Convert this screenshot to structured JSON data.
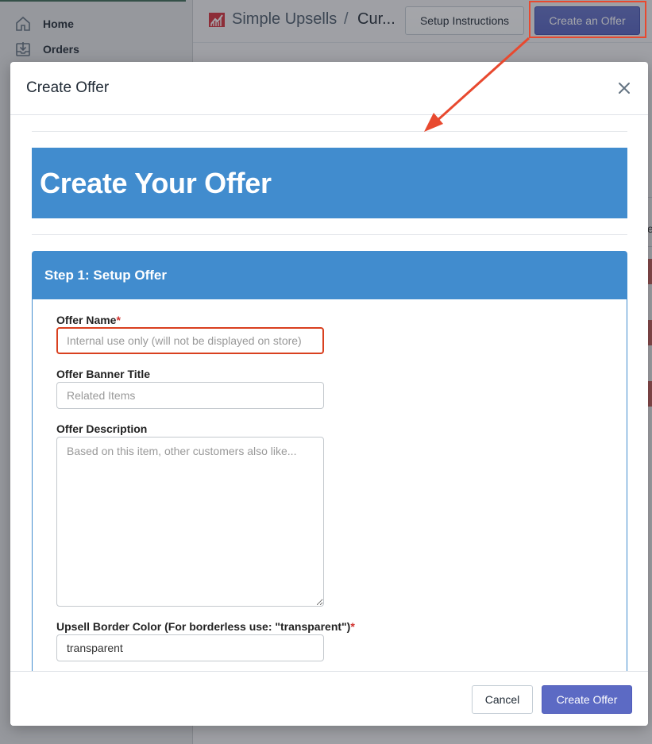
{
  "sidebar": {
    "items": [
      {
        "label": "Home",
        "icon": "home-icon"
      },
      {
        "label": "Orders",
        "icon": "orders-icon"
      }
    ]
  },
  "header": {
    "app_name": "Simple Upsells",
    "separator": "/",
    "current_page": "Cur...",
    "setup_button": "Setup Instructions",
    "create_button": "Create an Offer"
  },
  "background": {
    "partial_letter": "e"
  },
  "modal": {
    "title": "Create Offer",
    "banner_title": "Create Your Offer",
    "step_title": "Step 1: Setup Offer",
    "fields": {
      "offer_name": {
        "label": "Offer Name",
        "required_mark": "*",
        "placeholder": "Internal use only (will not be displayed on store)",
        "value": ""
      },
      "banner_title": {
        "label": "Offer Banner Title",
        "placeholder": "Related Items",
        "value": ""
      },
      "description": {
        "label": "Offer Description",
        "placeholder": "Based on this item, other customers also like...",
        "value": ""
      },
      "border_color": {
        "label": "Upsell Border Color (For borderless use: \"transparent\")",
        "required_mark": "*",
        "placeholder": "",
        "value": "transparent"
      }
    },
    "cancel_button": "Cancel",
    "submit_button": "Create Offer"
  },
  "colors": {
    "primary": "#5c6ac4",
    "banner_blue": "#418cce",
    "annotation_red": "#e8492f",
    "required_red": "#d0312d"
  }
}
